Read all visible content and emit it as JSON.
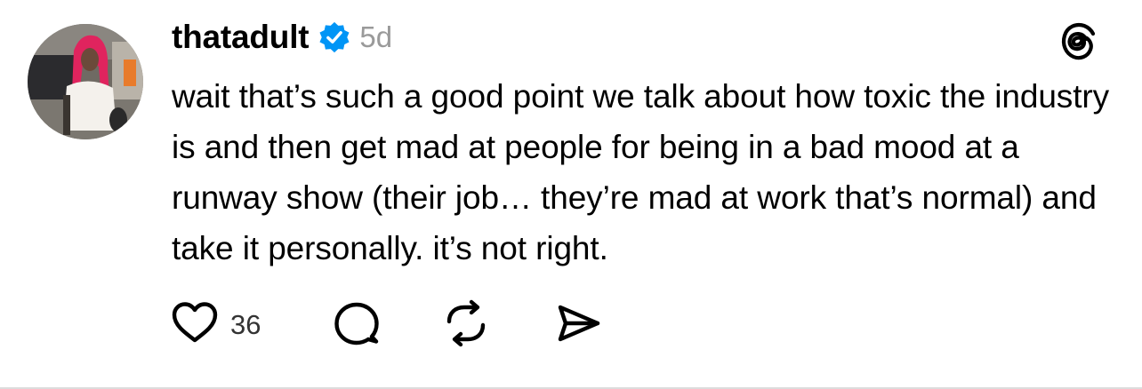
{
  "post": {
    "username": "thatadult",
    "time": "5d",
    "text": "wait that’s such a good point we talk about how toxic the industry is and then get mad at people for being in a bad mood at a runway show (their job… they’re mad at work that’s normal) and take it personally. it’s not right.",
    "like_count": "36"
  },
  "icons": {
    "verified": "verified-badge-icon",
    "app": "threads-logo-icon",
    "like": "heart-icon",
    "reply": "comment-bubble-icon",
    "repost": "repost-icon",
    "share": "send-icon"
  },
  "colors": {
    "verified_blue": "#0095f6",
    "timestamp_gray": "#9a9a9a",
    "avatar_hair": "#e0245e"
  }
}
